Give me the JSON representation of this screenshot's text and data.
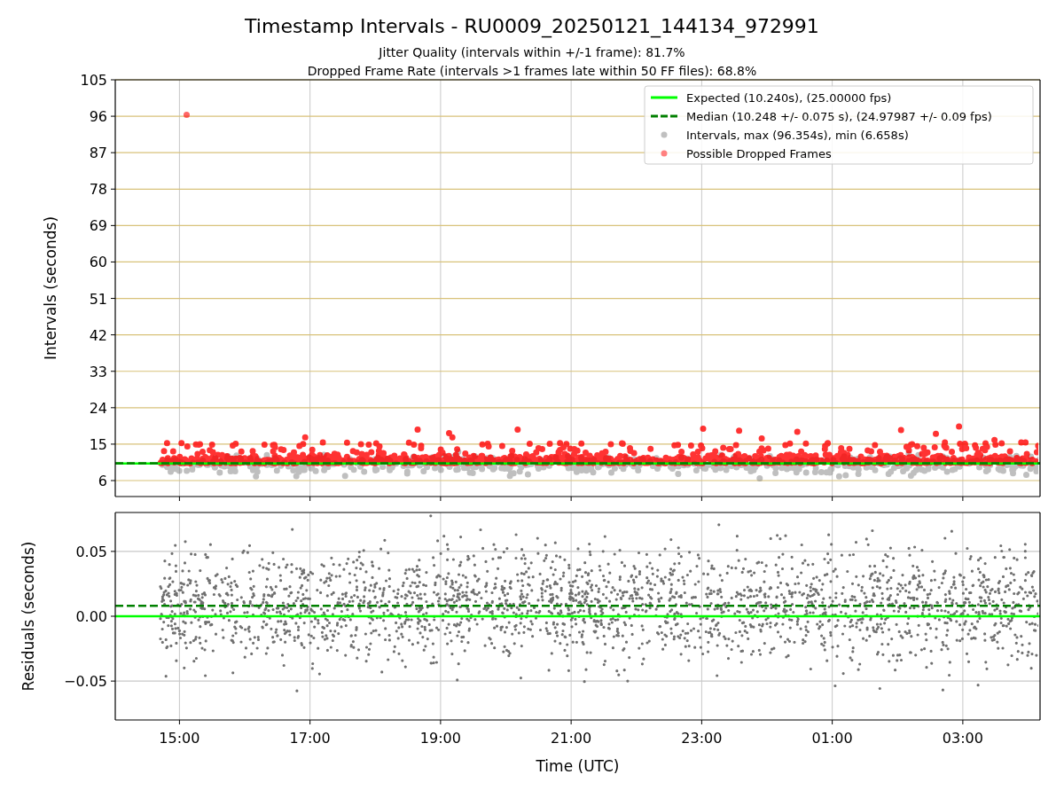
{
  "title": "Timestamp Intervals - RU0009_20250121_144134_972991",
  "subtitles": [
    "Jitter Quality (intervals within +/-1 frame): 81.7%",
    "Dropped Frame Rate (intervals >1 frames late within 50 FF files): 68.8%"
  ],
  "panels": [
    {
      "chart_data": {
        "type": "line",
        "grid": true,
        "ylabel": "Intervals (seconds)",
        "x": [
          "2025-01-21T14:01",
          "2025-01-22T04:11"
        ],
        "xlim": [
          "2025-01-21T14:01",
          "2025-01-22T04:11"
        ],
        "ylim": [
          2.06,
          105
        ],
        "yticks": [
          {
            "value": 6,
            "label": "6"
          },
          {
            "value": 15,
            "label": "15"
          },
          {
            "value": 24,
            "label": "24"
          },
          {
            "value": 33,
            "label": "33"
          },
          {
            "value": 42,
            "label": "42"
          },
          {
            "value": 51,
            "label": "51"
          },
          {
            "value": 60,
            "label": "60"
          },
          {
            "value": 69,
            "label": "69"
          },
          {
            "value": 78,
            "label": "78"
          },
          {
            "value": 87,
            "label": "87"
          },
          {
            "value": 96,
            "label": "96"
          },
          {
            "value": 105,
            "label": "105"
          }
        ],
        "series": [
          {
            "color": "#00ff00",
            "values": [
              10.24,
              10.24
            ]
          },
          {
            "color": "#008000",
            "line_style": "dashed",
            "values": [
              10.248,
              10.248
            ]
          }
        ]
      },
      "legend": [
        {
          "label": "Expected (10.240s), (25.00000 fps)",
          "kind": "line",
          "color": "#00ff00"
        },
        {
          "label": "Median (10.248 +/- 0.075 s), (24.97987 +/- 0.09 fps)",
          "kind": "dashed",
          "color": "#008000"
        },
        {
          "label": "Intervals, max (96.354s), min (6.658s)",
          "kind": "point",
          "color": "#c0c0c0"
        },
        {
          "label": "Possible Dropped Frames",
          "kind": "point",
          "color": "#ff8080"
        }
      ]
    },
    {
      "chart_data": {
        "type": "line",
        "grid": true,
        "xlabel": "Time (UTC)",
        "ylabel": "Residuals (seconds)",
        "x": [
          "2025-01-21T14:01",
          "2025-01-22T04:11"
        ],
        "xlim": [
          "2025-01-21T14:01",
          "2025-01-22T04:11"
        ],
        "ylim": [
          -0.08,
          0.08
        ],
        "xticks": [
          {
            "value": "2025-01-21T15:00",
            "label": "15:00"
          },
          {
            "value": "2025-01-21T17:00",
            "label": "17:00"
          },
          {
            "value": "2025-01-21T19:00",
            "label": "19:00"
          },
          {
            "value": "2025-01-21T21:00",
            "label": "21:00"
          },
          {
            "value": "2025-01-21T23:00",
            "label": "23:00"
          },
          {
            "value": "2025-01-22T01:00",
            "label": "01:00"
          },
          {
            "value": "2025-01-22T03:00",
            "label": "03:00"
          }
        ],
        "yticks": [
          {
            "value": -0.05,
            "label": "−0.05"
          },
          {
            "value": 0,
            "label": "0.00"
          },
          {
            "value": 0.05,
            "label": "0.05"
          }
        ],
        "series": [
          {
            "color": "#00ff00",
            "values": [
              0,
              0
            ]
          },
          {
            "color": "#008000",
            "line_style": "dashed",
            "values": [
              0.008,
              0.008
            ]
          }
        ]
      }
    }
  ]
}
